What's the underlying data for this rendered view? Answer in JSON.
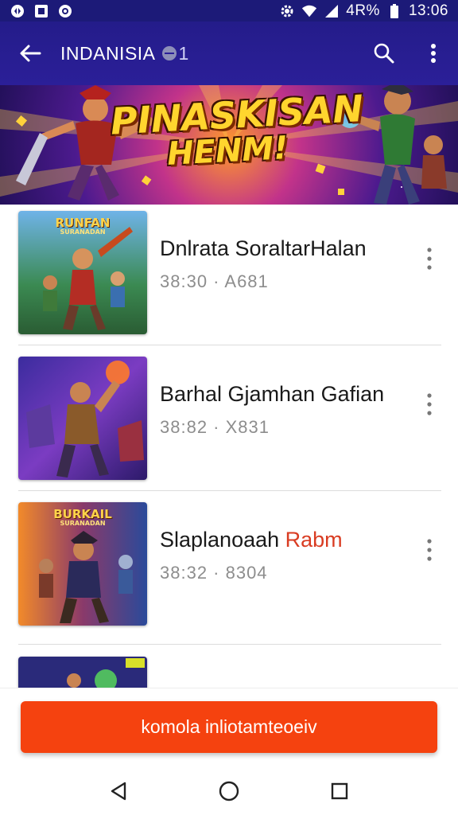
{
  "status_bar": {
    "time": "13:06",
    "battery_text": "4R%",
    "left_icons": [
      "notification-icon",
      "image-icon",
      "circle-app-icon"
    ],
    "right_icons": [
      "settings-gear-icon",
      "wifi-icon",
      "signal-icon"
    ]
  },
  "app_bar": {
    "title": "INDANISIA",
    "title_suffix": "1",
    "back_icon": "back-arrow-icon",
    "search_icon": "search-icon",
    "overflow_icon": "more-vert-icon"
  },
  "banner": {
    "line1": "PINASKISAN",
    "line2": "HENM!"
  },
  "items": [
    {
      "title": "Dnlrata SoraltarHalan",
      "title_accent": "",
      "meta": "38:30 · A681",
      "thumb_text_top": "RUNFAN",
      "thumb_text_sub": "SURANADAN"
    },
    {
      "title": "Barhal Gjamhan Gafian",
      "title_accent": "",
      "meta": "38:82 · X831",
      "thumb_text_top": "",
      "thumb_text_sub": ""
    },
    {
      "title": "Slaplanoaah ",
      "title_accent": "Rabm",
      "meta": "38:32 · 8304",
      "thumb_text_top": "BURKAIL",
      "thumb_text_sub": "SURANADAN"
    },
    {
      "title": "",
      "title_accent": "",
      "meta": "",
      "thumb_text_top": "",
      "thumb_text_sub": ""
    }
  ],
  "primary_button": {
    "label": "komola inliotamteoeiv"
  },
  "nav": {
    "back": "nav-back-icon",
    "home": "nav-home-icon",
    "recents": "nav-recents-icon"
  },
  "colors": {
    "status_bar": "#1c1a78",
    "app_bar": "#2b1f98",
    "primary": "#f5420f",
    "accent_text": "#d93c22"
  }
}
